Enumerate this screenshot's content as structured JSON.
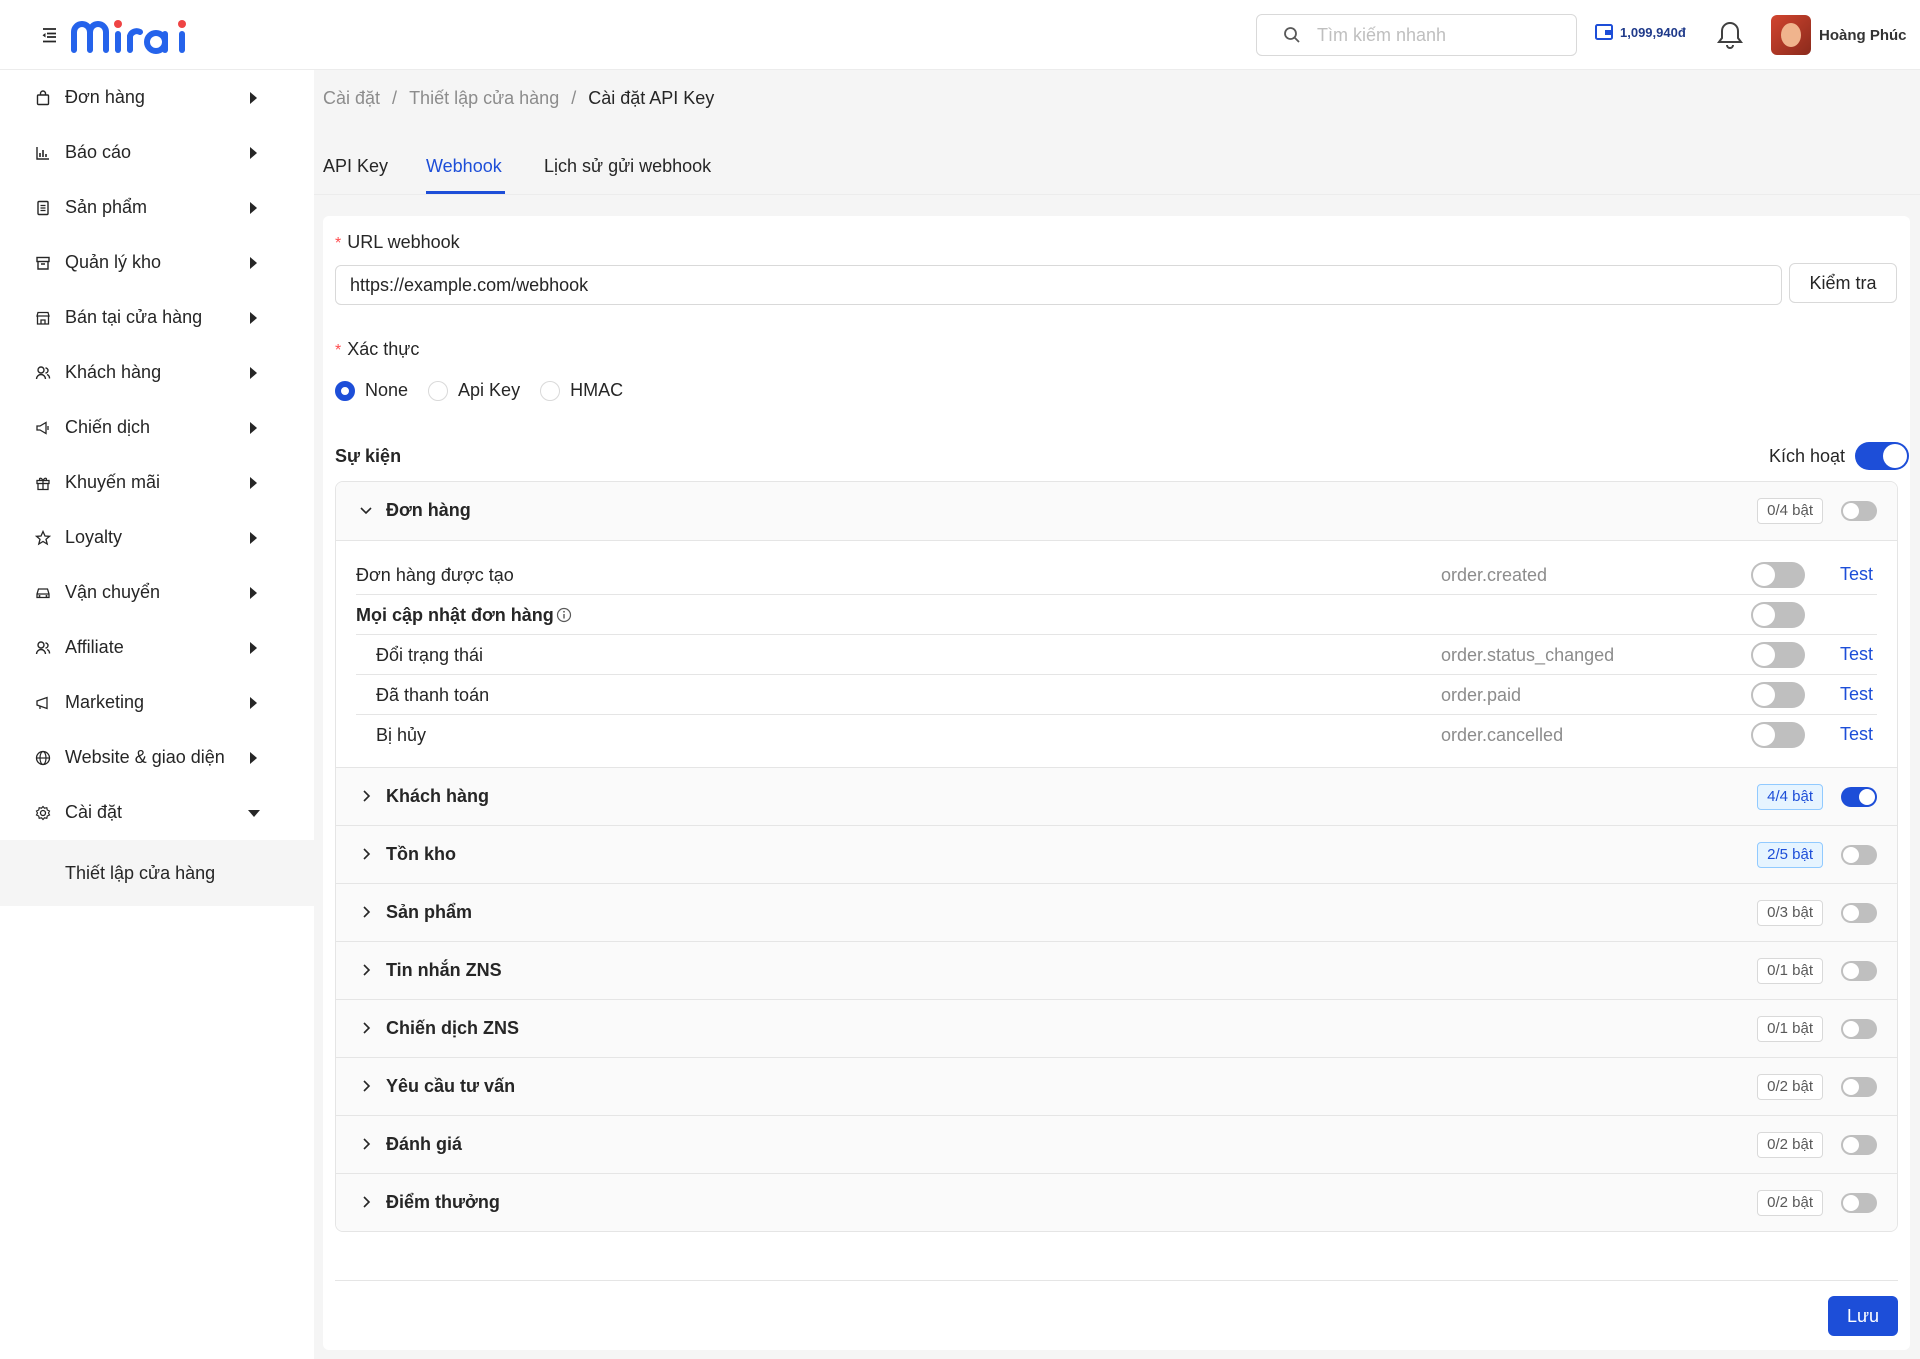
{
  "header": {
    "logo_text": "mirai",
    "search_placeholder": "Tìm kiếm nhanh",
    "wallet_amount": "1,099,940đ",
    "user_name": "Hoàng Phúc"
  },
  "sidebar": {
    "items": [
      {
        "label": "Đơn hàng",
        "icon": "bag-icon"
      },
      {
        "label": "Báo cáo",
        "icon": "bar-chart-icon"
      },
      {
        "label": "Sản phẩm",
        "icon": "document-icon"
      },
      {
        "label": "Quản lý kho",
        "icon": "archive-icon"
      },
      {
        "label": "Bán tại cửa hàng",
        "icon": "store-icon"
      },
      {
        "label": "Khách hàng",
        "icon": "users-icon"
      },
      {
        "label": "Chiến dịch",
        "icon": "megaphone-icon"
      },
      {
        "label": "Khuyến mãi",
        "icon": "gift-icon"
      },
      {
        "label": "Loyalty",
        "icon": "star-icon"
      },
      {
        "label": "Vận chuyển",
        "icon": "car-icon"
      },
      {
        "label": "Affiliate",
        "icon": "users-icon"
      },
      {
        "label": "Marketing",
        "icon": "speaker-icon"
      },
      {
        "label": "Website & giao diện",
        "icon": "globe-icon"
      },
      {
        "label": "Cài đặt",
        "icon": "gear-icon"
      }
    ],
    "sub_item": "Thiết lập cửa hàng"
  },
  "breadcrumb": [
    "Cài đặt",
    "Thiết lập cửa hàng",
    "Cài đặt API Key"
  ],
  "tabs": [
    "API Key",
    "Webhook",
    "Lịch sử gửi webhook"
  ],
  "form": {
    "url_label": "URL webhook",
    "url_value": "https://example.com/webhook",
    "check_button": "Kiểm tra",
    "auth_label": "Xác thực",
    "auth_options": [
      "None",
      "Api Key",
      "HMAC"
    ],
    "auth_selected": "None",
    "events_title": "Sự kiện",
    "activate_label": "Kích hoạt",
    "activate_on": true,
    "save_button": "Lưu"
  },
  "groups": [
    {
      "label": "Đơn hàng",
      "badge": "0/4 bật",
      "on": false,
      "expanded": true,
      "highlight": false,
      "events": [
        {
          "label": "Đơn hàng được tạo",
          "code": "order.created",
          "test": "Test"
        },
        {
          "label": "Mọi cập nhật đơn hàng",
          "code": "",
          "test": ""
        },
        {
          "label": "Đổi trạng thái",
          "code": "order.status_changed",
          "test": "Test"
        },
        {
          "label": "Đã thanh toán",
          "code": "order.paid",
          "test": "Test"
        },
        {
          "label": "Bị hủy",
          "code": "order.cancelled",
          "test": "Test"
        }
      ]
    },
    {
      "label": "Khách hàng",
      "badge": "4/4 bật",
      "on": true,
      "expanded": false,
      "highlight": true
    },
    {
      "label": "Tồn kho",
      "badge": "2/5 bật",
      "on": false,
      "expanded": false,
      "highlight": true
    },
    {
      "label": "Sản phẩm",
      "badge": "0/3 bật",
      "on": false,
      "expanded": false,
      "highlight": false
    },
    {
      "label": "Tin nhắn ZNS",
      "badge": "0/1 bật",
      "on": false,
      "expanded": false,
      "highlight": false
    },
    {
      "label": "Chiến dịch ZNS",
      "badge": "0/1 bật",
      "on": false,
      "expanded": false,
      "highlight": false
    },
    {
      "label": "Yêu cầu tư vấn",
      "badge": "0/2 bật",
      "on": false,
      "expanded": false,
      "highlight": false
    },
    {
      "label": "Đánh giá",
      "badge": "0/2 bật",
      "on": false,
      "expanded": false,
      "highlight": false
    },
    {
      "label": "Điểm thưởng",
      "badge": "0/2 bật",
      "on": false,
      "expanded": false,
      "highlight": false
    }
  ],
  "colors": {
    "accent": "#1d4ed8",
    "required": "#ff4d4f",
    "muted": "#8c8c8c"
  }
}
